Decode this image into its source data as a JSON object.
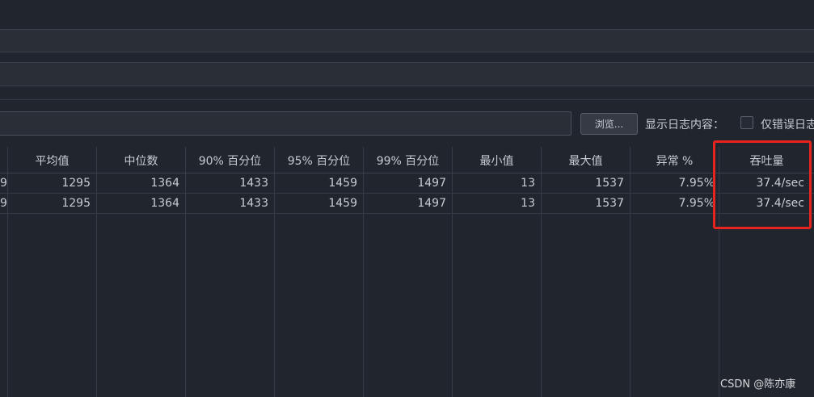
{
  "toolbar": {
    "browse_label": "浏览...",
    "log_content_label": "显示日志内容：",
    "errors_only_label": "仅错误日志"
  },
  "table": {
    "columns": [
      "平均值",
      "中位数",
      "90% 百分位",
      "95% 百分位",
      "99% 百分位",
      "最小值",
      "最大值",
      "异常 %",
      "吞吐量"
    ],
    "partial_first_column_values": [
      "9",
      "9"
    ],
    "rows": [
      [
        "1295",
        "1364",
        "1433",
        "1459",
        "1497",
        "13",
        "1537",
        "7.95%",
        "37.4/sec"
      ],
      [
        "1295",
        "1364",
        "1433",
        "1459",
        "1497",
        "13",
        "1537",
        "7.95%",
        "37.4/sec"
      ]
    ]
  },
  "watermark": "CSDN @陈亦康",
  "colors": {
    "background": "#21252d",
    "highlight": "#e8241f"
  }
}
